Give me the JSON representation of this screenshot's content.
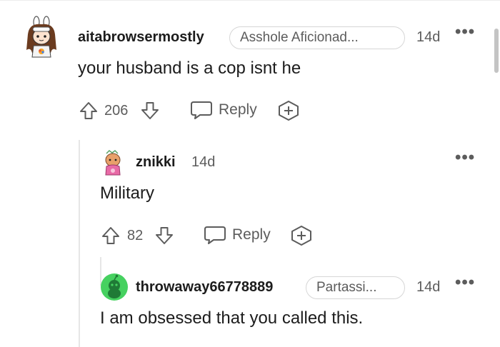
{
  "comments": [
    {
      "username": "aitabrowsermostly",
      "flair": "Asshole Aficionad...",
      "time": "14d",
      "more": "•••",
      "body": "your husband is a cop isnt he",
      "votes": "206",
      "reply_label": "Reply"
    },
    {
      "username": "znikki",
      "time": "14d",
      "more": "•••",
      "body": "Military",
      "votes": "82",
      "reply_label": "Reply"
    },
    {
      "username": "throwaway66778889",
      "flair": "Partassi...",
      "time": "14d",
      "more": "•••",
      "body": "I am obsessed that you called this."
    }
  ],
  "colors": {
    "text": "#1c1c1c",
    "meta": "#5c5c5c",
    "thread_line": "#e6e6e6",
    "avatar_green": "#46d160"
  },
  "icons": [
    "upvote-icon",
    "downvote-icon",
    "comment-bubble-icon",
    "award-plus-icon",
    "more-icon",
    "scrollbar-thumb"
  ]
}
